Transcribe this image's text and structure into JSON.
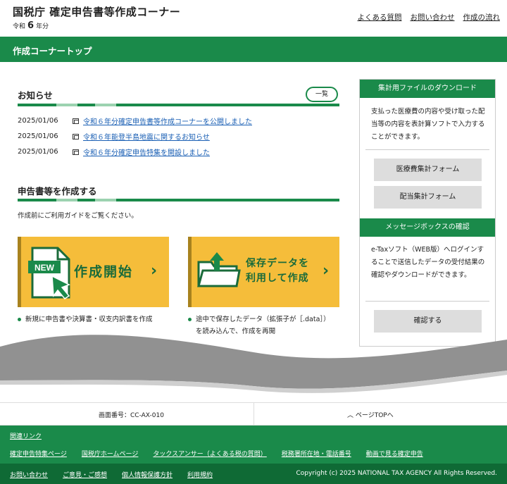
{
  "header": {
    "title": "国税庁 確定申告書等作成コーナー",
    "era_prefix": "令和",
    "era_year": "6",
    "era_suffix": "年分",
    "links": [
      "よくある質問",
      "お問い合わせ",
      "作成の流れ"
    ]
  },
  "nav": {
    "label": "作成コーナートップ"
  },
  "news": {
    "title": "お知らせ",
    "more_label": "一覧",
    "items": [
      {
        "date": "2025/01/06",
        "text": "令和６年分確定申告書等作成コーナーを公開しました"
      },
      {
        "date": "2025/01/06",
        "text": "令和６年能登半島地震に関するお知らせ"
      },
      {
        "date": "2025/01/06",
        "text": "令和６年分確定申告特集を開設しました"
      }
    ]
  },
  "create": {
    "title": "申告書等を作成する",
    "intro": "作成前にご利用ガイドをご覧ください。",
    "new_card": {
      "badge": "NEW",
      "label": "作成開始",
      "note": "新規に申告書や決算書・収支内訳書を作成"
    },
    "resume_card": {
      "line1": "保存データを",
      "line2": "利用して作成",
      "note_line1": "途中で保存したデータ（拡張子が［.data］）",
      "note_line2": "を読み込んで、作成を再開"
    }
  },
  "sidebar": {
    "download": {
      "heading": "集計用ファイルのダウンロード",
      "text": "支払った医療費の内容や受け取った配当等の内容を表計算ソフトで入力することができます。",
      "buttons": [
        "医療費集計フォーム",
        "配当集計フォーム"
      ]
    },
    "message": {
      "heading": "メッセージボックスの確認",
      "text": "e-Taxソフト（WEB版）へログインすることで送信したデータの受付結果の確認やダウンロードができます。",
      "button": "確認する"
    }
  },
  "footer": {
    "screen_number": "画面番号：CC-AX-010",
    "page_top": "ページTOPへ",
    "related_label": "関連リンク",
    "related_links": [
      "確定申告特集ページ",
      "国税庁ホームページ",
      "タックスアンサー（よくある税の質問）",
      "税務署所在地・電話番号",
      "動画で見る確定申告"
    ],
    "bottom_links": [
      "お問い合わせ",
      "ご意見・ご感想",
      "個人情報保護方針",
      "利用規約"
    ],
    "copyright": "Copyright (c) 2025 NATIONAL TAX AGENCY All Rights Reserved."
  },
  "colors": {
    "brand_green": "#1a8a4a",
    "card_yellow": "#f5bd3a",
    "link_blue": "#1a5fb4"
  }
}
